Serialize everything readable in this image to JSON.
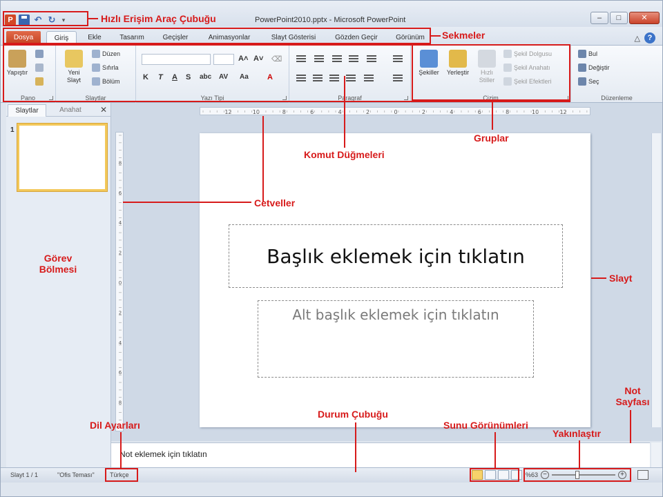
{
  "window": {
    "app_icon": "P",
    "title": "PowerPoint2010.pptx - Microsoft PowerPoint",
    "minimize": "–",
    "maximize": "□",
    "close": "✕"
  },
  "quick_access": {
    "undo": "↶",
    "redo": "↻",
    "more": "▾"
  },
  "tabs": [
    "Dosya",
    "Giriş",
    "Ekle",
    "Tasarım",
    "Geçişler",
    "Animasyonlar",
    "Slayt Gösterisi",
    "Gözden Geçir",
    "Görünüm"
  ],
  "ribbon": {
    "pano": {
      "label": "Pano",
      "paste": "Yapıştır"
    },
    "slaytlar": {
      "label": "Slaytlar",
      "new_slide": "Yeni Slayt",
      "layout": "Düzen",
      "reset": "Sıfırla",
      "section": "Bölüm"
    },
    "yazi_tipi": {
      "label": "Yazı Tipi",
      "bold": "K",
      "italic": "T",
      "underline": "A",
      "strike": "S",
      "shadow": "abc",
      "spacing": "AV",
      "case": "Aa",
      "color": "A"
    },
    "paragraf": {
      "label": "Paragraf"
    },
    "cizim": {
      "label": "Çizim",
      "shapes": "Şekiller",
      "arrange": "Yerleştir",
      "quick_styles": "Hızlı Stiller",
      "fill": "Şekil Dolgusu",
      "outline": "Şekil Anahatı",
      "effects": "Şekil Efektleri"
    },
    "duzenleme": {
      "label": "Düzenleme",
      "find": "Bul",
      "replace": "Değiştir",
      "select": "Seç"
    }
  },
  "left_pane": {
    "tab_slides": "Slaytlar",
    "tab_outline": "Anahat",
    "close": "✕",
    "thumb_number": "1"
  },
  "slide": {
    "title_placeholder": "Başlık eklemek için tıklatın",
    "subtitle_placeholder": "Alt başlık eklemek için tıklatın"
  },
  "notes": {
    "placeholder": "Not eklemek için tıklatın"
  },
  "status": {
    "slide_count": "Slayt 1 / 1",
    "theme": "\"Ofis Teması\"",
    "language": "Türkçe",
    "zoom": "%63",
    "zoom_minus": "−",
    "zoom_plus": "+"
  },
  "ruler_labels": {
    "horizontal": [
      "12",
      "10",
      "8",
      "6",
      "4",
      "2",
      "0",
      "2",
      "4",
      "6",
      "8",
      "10",
      "12"
    ],
    "vertical": [
      "8",
      "6",
      "4",
      "2",
      "0",
      "2",
      "4",
      "6",
      "8"
    ]
  },
  "annotations": {
    "qat": "Hızlı Erişim Araç Çubuğu",
    "tabs": "Sekmeler",
    "groups": "Gruplar",
    "commands": "Komut Düğmeleri",
    "rulers": "Cetveller",
    "task_pane": "Görev Bölmesi",
    "slide": "Slayt",
    "notes_page": "Not Sayfası",
    "zoom": "Yakınlaştır",
    "views": "Sunu Görünümleri",
    "status_bar": "Durum Çubuğu",
    "language": "Dil Ayarları"
  },
  "colors": {
    "annotation": "#d71a1a",
    "file_tab": "#d24726",
    "ribbon_bg": "#f0f4f9",
    "selection": "#f3c85a"
  }
}
